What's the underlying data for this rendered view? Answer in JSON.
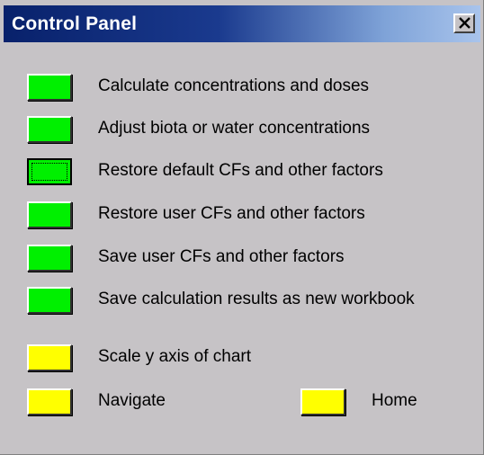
{
  "window": {
    "title": "Control Panel",
    "close_glyph": "×"
  },
  "colors": {
    "title_bar": "#08216b",
    "window_bg": "#c6c3c6",
    "action_green": "#00f000",
    "action_yellow": "#ffff00"
  },
  "actions": [
    {
      "label": "Calculate concentrations and doses",
      "color": "green",
      "focused": false
    },
    {
      "label": "Adjust biota or water concentrations",
      "color": "green",
      "focused": false
    },
    {
      "label": "Restore default CFs and other factors",
      "color": "green",
      "focused": true
    },
    {
      "label": "Restore user CFs and other factors",
      "color": "green",
      "focused": false
    },
    {
      "label": "Save user CFs and other factors",
      "color": "green",
      "focused": false
    },
    {
      "label": "Save calculation results as new workbook",
      "color": "green",
      "focused": false
    },
    {
      "label": "Scale y axis of chart",
      "color": "yellow",
      "focused": false
    },
    {
      "label": "Navigate",
      "color": "yellow",
      "focused": false
    },
    {
      "label": "Home",
      "color": "yellow",
      "focused": false
    }
  ]
}
